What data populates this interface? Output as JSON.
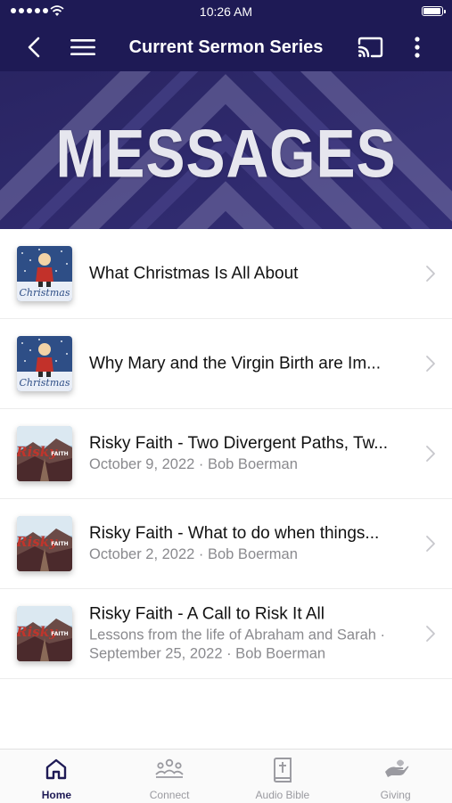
{
  "status_bar": {
    "time": "10:26 AM"
  },
  "nav": {
    "title": "Current Sermon Series",
    "back_icon": "chevron-left-icon",
    "menu_icon": "hamburger-menu-icon",
    "cast_icon": "cast-icon",
    "more_icon": "more-vertical-icon"
  },
  "banner": {
    "title": "MESSAGES"
  },
  "sermons": [
    {
      "title": "What Christmas Is All About",
      "subtitle_1": "",
      "subtitle_2": "",
      "thumb": "charlie-brown-christmas"
    },
    {
      "title": "Why Mary and the Virgin Birth are Im...",
      "subtitle_1": "",
      "subtitle_2": "",
      "thumb": "charlie-brown-christmas"
    },
    {
      "title": "Risky Faith - Two Divergent Paths, Tw...",
      "subtitle_1": "October 9, 2022 · Bob Boerman",
      "subtitle_2": "",
      "thumb": "risky-faith"
    },
    {
      "title": "Risky Faith - What to do when things...",
      "subtitle_1": "October 2, 2022 · Bob Boerman",
      "subtitle_2": "",
      "thumb": "risky-faith"
    },
    {
      "title": "Risky Faith - A Call to Risk It All",
      "subtitle_1": "Lessons from the life of Abraham and Sarah ·",
      "subtitle_2": "September 25, 2022 · Bob Boerman",
      "thumb": "risky-faith"
    }
  ],
  "tabs": [
    {
      "label": "Home",
      "icon": "home-icon",
      "active": true
    },
    {
      "label": "Connect",
      "icon": "people-icon",
      "active": false
    },
    {
      "label": "Audio Bible",
      "icon": "bible-icon",
      "active": false
    },
    {
      "label": "Giving",
      "icon": "giving-hand-icon",
      "active": false
    }
  ],
  "colors": {
    "primary": "#1e1a55",
    "banner_bg": "#2a2566",
    "secondary_text": "#8a8a8e"
  }
}
